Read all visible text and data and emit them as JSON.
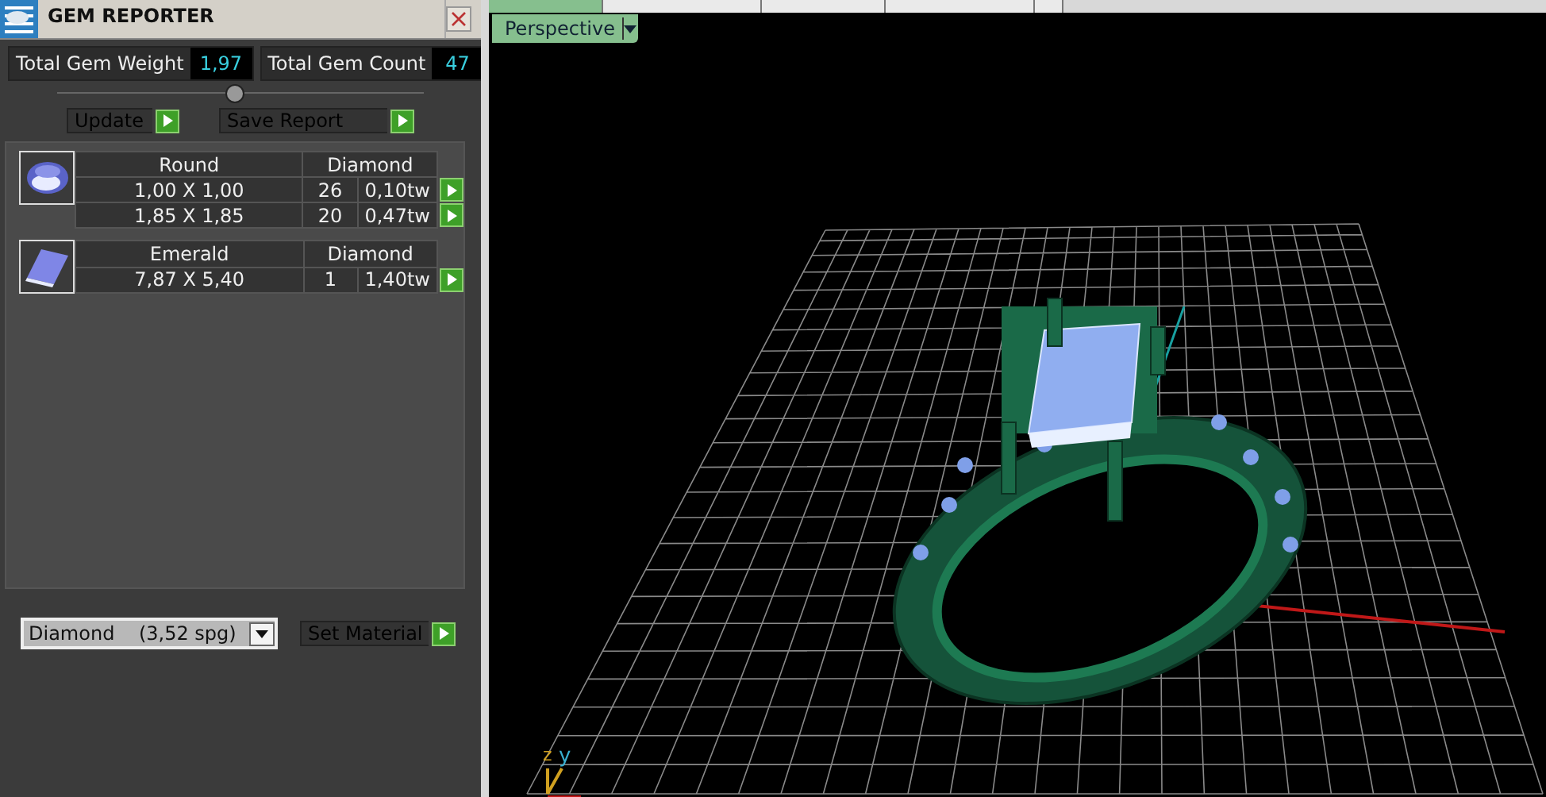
{
  "panel": {
    "title": "GEM REPORTER",
    "totals": [
      {
        "label": "Total Gem Weight",
        "value": "1,97"
      },
      {
        "label": "Total Gem Count",
        "value": "47"
      }
    ],
    "buttons": [
      "Update",
      "Save Report"
    ],
    "gems": [
      {
        "kind": "round",
        "shape": "Round",
        "material": "Diamond",
        "sizes": [
          {
            "size": "1,00 X 1,00",
            "count": "26",
            "weight": "0,10tw"
          },
          {
            "size": "1,85 X 1,85",
            "count": "20",
            "weight": "0,47tw"
          }
        ]
      },
      {
        "kind": "emerald",
        "shape": "Emerald",
        "material": "Diamond",
        "sizes": [
          {
            "size": "7,87 X 5,40",
            "count": "1",
            "weight": "1,40tw"
          }
        ]
      }
    ],
    "material_select": {
      "value": "Diamond    (3,52 spg)"
    },
    "set_material": "Set Material"
  },
  "viewport": {
    "tabs": [
      {
        "selected": true
      },
      {
        "selected": false
      },
      {
        "selected": false
      },
      {
        "selected": false
      },
      {
        "selected": false
      }
    ],
    "view_menu": "Perspective",
    "axes": [
      "z",
      "y"
    ]
  }
}
